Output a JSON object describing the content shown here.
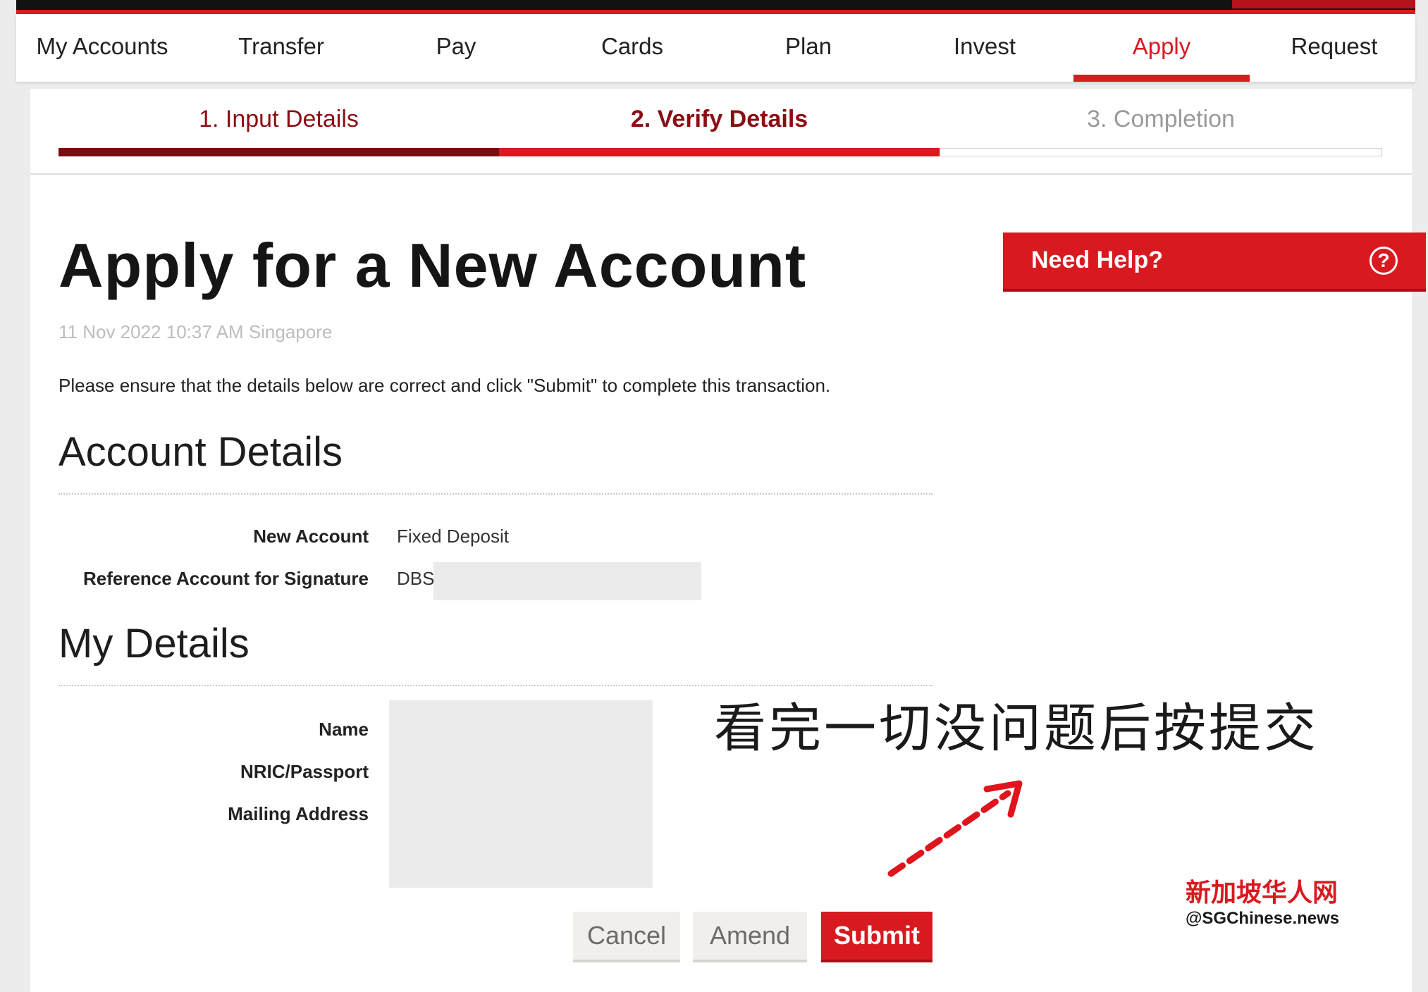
{
  "nav": {
    "items": [
      {
        "label": "My Accounts",
        "active": false
      },
      {
        "label": "Transfer",
        "active": false
      },
      {
        "label": "Pay",
        "active": false
      },
      {
        "label": "Cards",
        "active": false
      },
      {
        "label": "Plan",
        "active": false
      },
      {
        "label": "Invest",
        "active": false
      },
      {
        "label": "Apply",
        "active": true
      },
      {
        "label": "Request",
        "active": false
      }
    ]
  },
  "steps": [
    {
      "label": "1. Input Details",
      "state": "done"
    },
    {
      "label": "2. Verify Details",
      "state": "current"
    },
    {
      "label": "3. Completion",
      "state": "pending"
    }
  ],
  "page": {
    "title": "Apply for a New Account",
    "timestamp": "11 Nov 2022 10:37 AM Singapore",
    "instruction": "Please ensure that the details below are correct and click \"Submit\" to complete this transaction."
  },
  "help": {
    "label": "Need Help?",
    "icon": "question-circle-icon",
    "icon_glyph": "?"
  },
  "account_details": {
    "heading": "Account Details",
    "rows": [
      {
        "label": "New Account",
        "value": "Fixed Deposit"
      },
      {
        "label": "Reference Account for Signature",
        "value": "DBS"
      }
    ]
  },
  "my_details": {
    "heading": "My Details",
    "rows": [
      {
        "label": "Name"
      },
      {
        "label": "NRIC/Passport"
      },
      {
        "label": "Mailing Address"
      }
    ]
  },
  "buttons": {
    "cancel": "Cancel",
    "amend": "Amend",
    "submit": "Submit"
  },
  "annotation": {
    "text": "看完一切没问题后按提交"
  },
  "watermark": {
    "cn": "新加坡华人网",
    "en": "@SGChinese.news"
  },
  "colors": {
    "brand_red": "#d81a20",
    "step_done": "#7a0d12",
    "step_text_active": "#8b0d14",
    "step_pending_text": "#9a9a9a"
  }
}
